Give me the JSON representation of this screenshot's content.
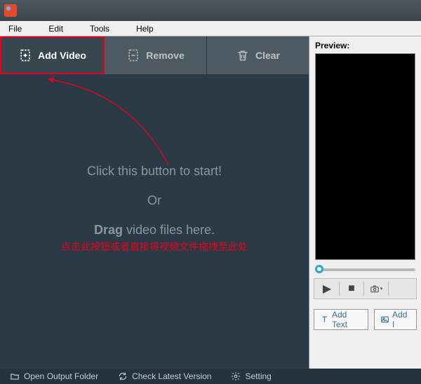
{
  "menu": {
    "file": "File",
    "edit": "Edit",
    "tools": "Tools",
    "help": "Help"
  },
  "toolbar": {
    "add_video": "Add Video",
    "remove": "Remove",
    "clear": "Clear"
  },
  "drop": {
    "line1": "Click this button to start!",
    "or": "Or",
    "line2_bold": "Drag",
    "line2_rest": " video files here."
  },
  "annotation": "点击此按钮或者直接将视频文件拖拽至此处",
  "preview": {
    "label": "Preview:"
  },
  "actions": {
    "add_text": "Add Text",
    "add_image": "Add I"
  },
  "footer": {
    "open_output": "Open Output Folder",
    "check_version": "Check Latest Version",
    "setting": "Setting"
  }
}
